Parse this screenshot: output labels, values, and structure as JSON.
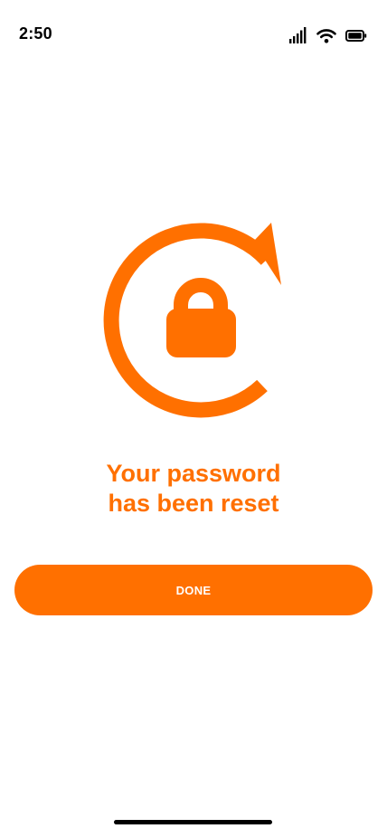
{
  "status_bar": {
    "time": "2:50",
    "icons": [
      "cellular-signal-icon",
      "wifi-icon",
      "battery-icon"
    ]
  },
  "hero": {
    "icon": "lock-reset-icon"
  },
  "message": {
    "line1": "Your password",
    "line2": "has been reset"
  },
  "actions": {
    "done_label": "DONE"
  },
  "colors": {
    "accent": "#FF7000",
    "button_text": "#FFFFFF",
    "background": "#FFFFFF"
  }
}
